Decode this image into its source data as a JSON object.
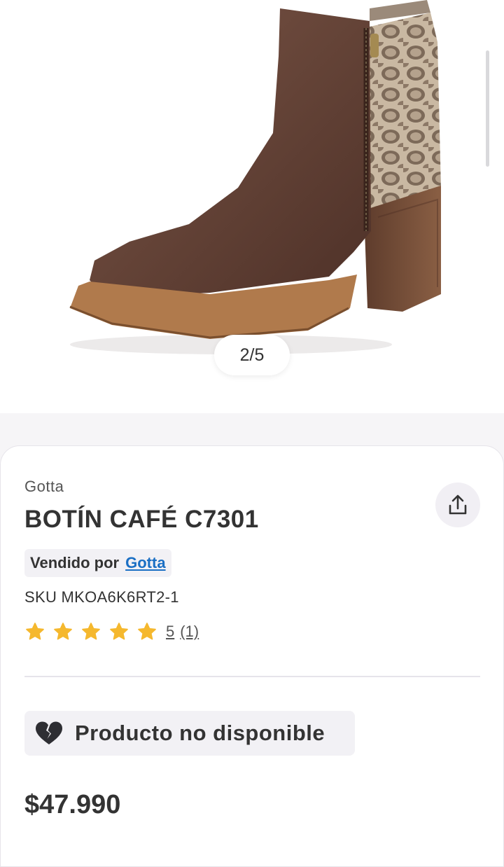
{
  "gallery": {
    "counter": "2/5",
    "image_alt": "brown ankle boot with snakeskin panel"
  },
  "product": {
    "brand": "Gotta",
    "title": "BOTÍN CAFÉ C7301",
    "seller_prefix": "Vendido por",
    "seller_name": "Gotta",
    "sku": "SKU MKOA6K6RT2-1",
    "rating_value": "5",
    "rating_count": "(1)",
    "stars": 5,
    "availability": "Producto no disponible",
    "price": "$47.990"
  },
  "icons": {
    "share": "share-icon",
    "star": "star-icon",
    "broken_heart": "broken-heart-icon"
  },
  "colors": {
    "link": "#1a6fc4",
    "star": "#f5b82e",
    "text": "#333333"
  }
}
